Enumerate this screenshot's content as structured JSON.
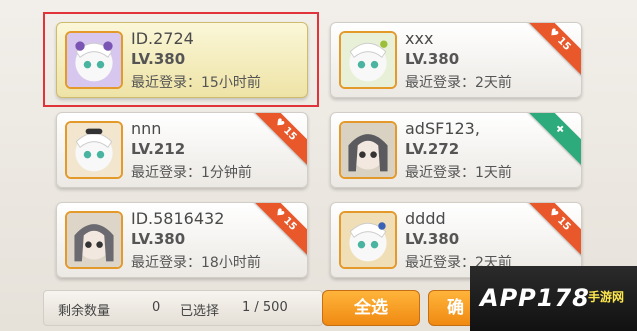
{
  "accounts": [
    {
      "name": "ID.2724",
      "level": "LV.380",
      "login": "最近登录：15小时前",
      "ribbon": ""
    },
    {
      "name": "xxx",
      "level": "LV.380",
      "login": "最近登录：2天前",
      "ribbon": "15"
    },
    {
      "name": "nnn",
      "level": "LV.212",
      "login": "最近登录：1分钟前",
      "ribbon": "15"
    },
    {
      "name": "adSF123,",
      "level": "LV.272",
      "login": "最近登录：1天前",
      "ribbon": ""
    },
    {
      "name": "ID.5816432",
      "level": "LV.380",
      "login": "最近登录：18小时前",
      "ribbon": "15"
    },
    {
      "name": "dddd",
      "level": "LV.380",
      "login": "最近登录：2天前",
      "ribbon": "15"
    }
  ],
  "footer": {
    "remaining_label": "剩余数量",
    "remaining_value": "0",
    "selected_label": "已选择",
    "selected_value": "1 / 500",
    "select_all": "全选",
    "next_partial": "确"
  },
  "watermark": {
    "main": "APP178",
    "sub": "手游网"
  }
}
